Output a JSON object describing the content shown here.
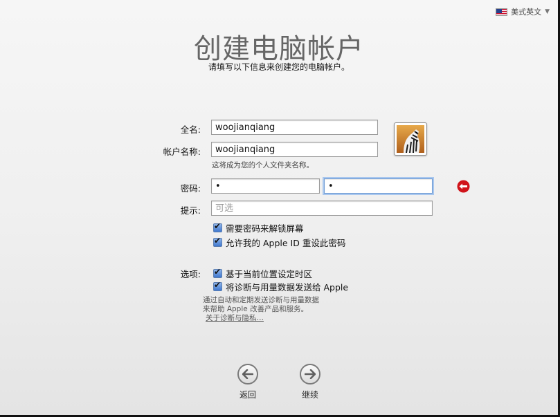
{
  "language": {
    "flag": "us-flag-icon",
    "label": "美式英文",
    "chevron": "▼"
  },
  "header": {
    "title": "创建电脑帐户",
    "subtitle": "请填写以下信息来创建您的电脑帐户。"
  },
  "form": {
    "full_name_label": "全名:",
    "full_name_value": "woojianqiang",
    "account_name_label": "帐户名称:",
    "account_name_value": "woojianqiang",
    "account_name_hint": "这将成为您的个人文件夹名称。",
    "password_label": "密码:",
    "password_value": "•",
    "verify_value": "•",
    "hint_label": "提示:",
    "hint_placeholder": "可选",
    "require_password_label": "需要密码来解锁屏幕",
    "allow_appleid_label": "允许我的 Apple ID 重设此密码",
    "options_label": "选项:",
    "timezone_label": "基于当前位置设定时区",
    "diagnostics_label": "将诊断与用量数据发送给 Apple"
  },
  "info": {
    "line1": "通过自动和定期发送诊断与用量数据",
    "line2": "来帮助 Apple 改善产品和服务。",
    "link": "关于诊断与隐私…"
  },
  "nav": {
    "back_label": "返回",
    "continue_label": "继续"
  },
  "colors": {
    "error_red": "#d0141a",
    "focus_blue": "#a9c7ee",
    "checkbox_blue": "#3f78cf"
  }
}
